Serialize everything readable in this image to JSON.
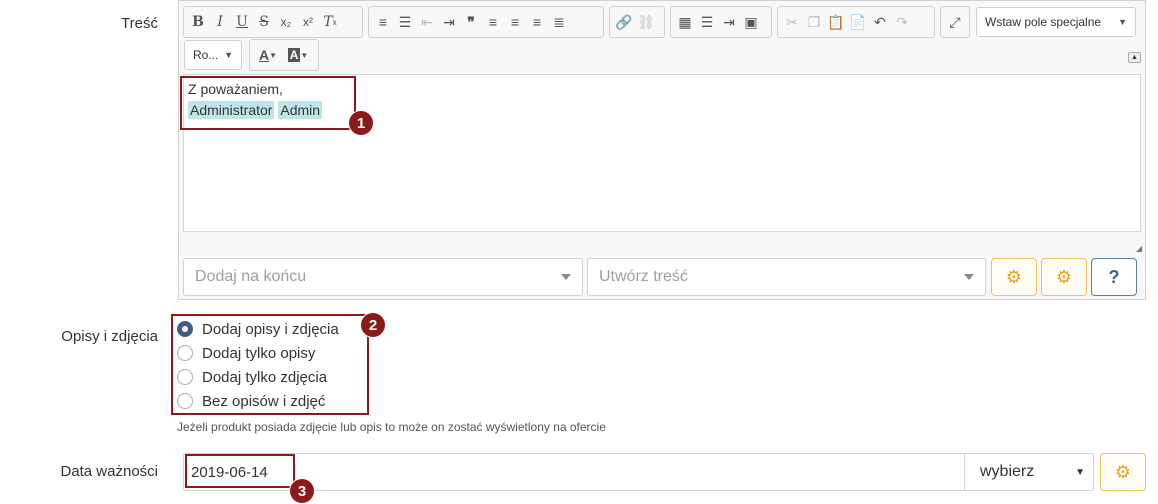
{
  "labels": {
    "content": "Treść",
    "descriptions": "Opisy i zdjęcia",
    "expiry": "Data ważności"
  },
  "toolbar": {
    "special_field": "Wstaw pole specjalne",
    "font": "Ro...",
    "text_color": "A",
    "bg_color": "A"
  },
  "editor": {
    "line1": "Z poważaniem,",
    "tag1": "Administrator",
    "tag2": "Admin"
  },
  "controls": {
    "append_placeholder": "Dodaj na końcu",
    "create_placeholder": "Utwórz treść"
  },
  "radios": {
    "options": [
      "Dodaj opisy i zdjęcia",
      "Dodaj tylko opisy",
      "Dodaj tylko zdjęcia",
      "Bez opisów i zdjęć"
    ],
    "selected_index": 0
  },
  "hint": "Jeżeli produkt posiada zdjęcie lub opis to może on zostać wyświetlony na ofercie",
  "date": {
    "value": "2019-06-14",
    "select_label": "wybierz"
  },
  "callouts": [
    "1",
    "2",
    "3"
  ],
  "colors": {
    "callout": "#8b1a1a",
    "tag_bg": "#bfe6e6",
    "primary": "#3d5f86",
    "warning": "#e8a317"
  }
}
